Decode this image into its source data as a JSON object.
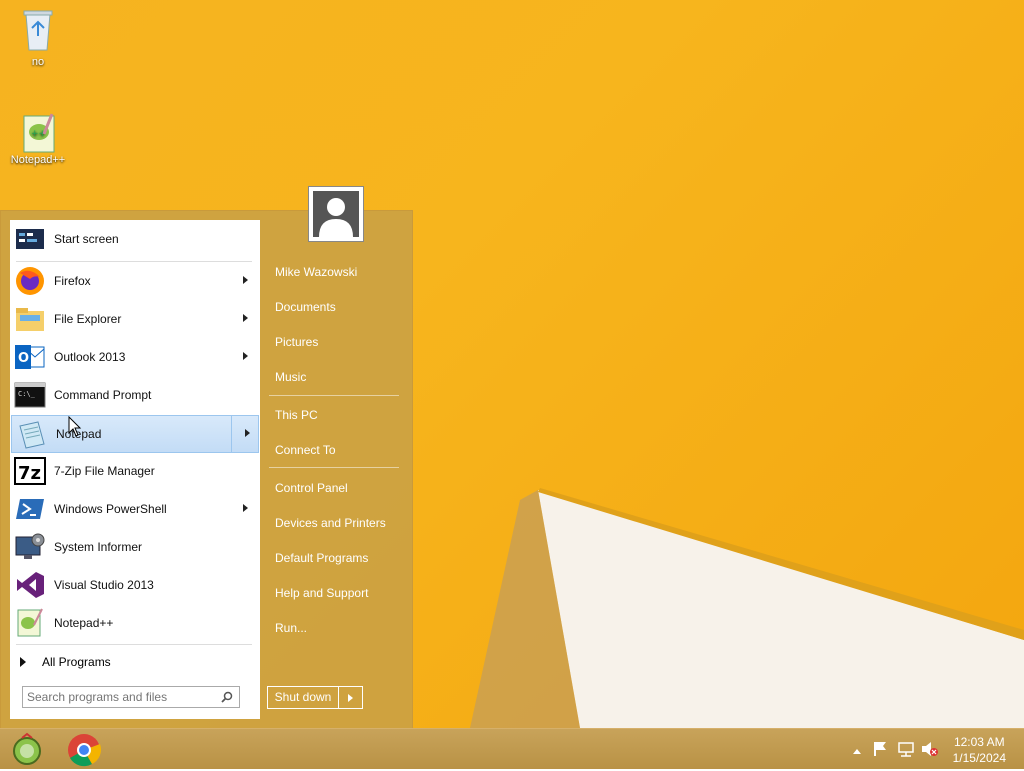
{
  "desktop": {
    "icons": [
      {
        "label": "no",
        "icon": "recycle-bin-icon"
      },
      {
        "label": "Notepad++",
        "icon": "notepad-plus-plus-icon"
      }
    ]
  },
  "start_menu": {
    "pinned": [
      {
        "label": "Start screen",
        "icon": "start-screen-icon",
        "submenu": false
      },
      {
        "label": "Firefox",
        "icon": "firefox-icon",
        "submenu": true
      },
      {
        "label": "File Explorer",
        "icon": "folder-icon",
        "submenu": true
      },
      {
        "label": "Outlook 2013",
        "icon": "outlook-icon",
        "submenu": true
      },
      {
        "label": "Command Prompt",
        "icon": "console-icon",
        "submenu": false
      },
      {
        "label": "Notepad",
        "icon": "notepad-icon",
        "submenu": true,
        "highlighted": true
      },
      {
        "label": "7-Zip File Manager",
        "icon": "7zip-icon",
        "submenu": false
      },
      {
        "label": "Windows PowerShell",
        "icon": "powershell-icon",
        "submenu": true
      },
      {
        "label": "System Informer",
        "icon": "system-informer-icon",
        "submenu": false
      },
      {
        "label": "Visual Studio 2013",
        "icon": "visual-studio-icon",
        "submenu": false
      },
      {
        "label": "Notepad++",
        "icon": "notepad-plus-plus-icon",
        "submenu": false
      }
    ],
    "all_programs_label": "All Programs",
    "search_placeholder": "Search programs and files",
    "right_links": [
      {
        "label": "Mike Wazowski"
      },
      {
        "label": "Documents"
      },
      {
        "label": "Pictures"
      },
      {
        "label": "Music"
      },
      {
        "label": "This PC"
      },
      {
        "label": "Connect To"
      },
      {
        "label": "Control Panel"
      },
      {
        "label": "Devices and Printers"
      },
      {
        "label": "Default Programs"
      },
      {
        "label": "Help and Support"
      },
      {
        "label": "Run..."
      }
    ],
    "shutdown_label": "Shut down"
  },
  "taskbar": {
    "apps": [
      {
        "icon": "start-orb-icon"
      },
      {
        "icon": "chrome-icon"
      }
    ],
    "tray": {
      "time": "12:03 AM",
      "date": "1/15/2024"
    }
  },
  "colors": {
    "desktop": "#f6b320",
    "menu_frame": "#c8a046",
    "highlight": "#c3dcf6"
  }
}
